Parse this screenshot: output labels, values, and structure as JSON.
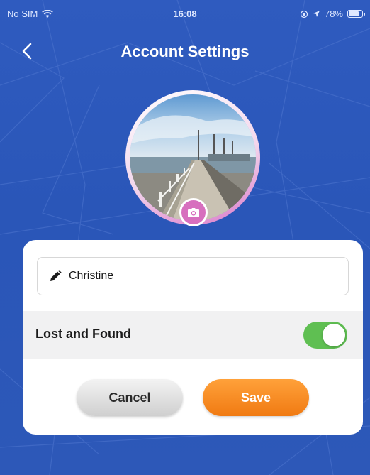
{
  "status_bar": {
    "carrier": "No SIM",
    "time": "16:08",
    "battery_percent_text": "78%",
    "battery_level": 0.78
  },
  "nav": {
    "title": "Account Settings",
    "back_icon": "chevron-left-icon"
  },
  "profile": {
    "avatar_image": "pier-photo",
    "camera_icon": "camera-icon"
  },
  "form": {
    "name_value": "Christine",
    "edit_icon": "pencil-icon",
    "lost_and_found_label": "Lost and Found",
    "lost_and_found_enabled": true,
    "cancel_label": "Cancel",
    "save_label": "Save"
  },
  "colors": {
    "background": "#2c55b6",
    "toggle_on": "#5fbf52",
    "save_button": "#f58a1f",
    "avatar_ring": "#d877c9"
  }
}
